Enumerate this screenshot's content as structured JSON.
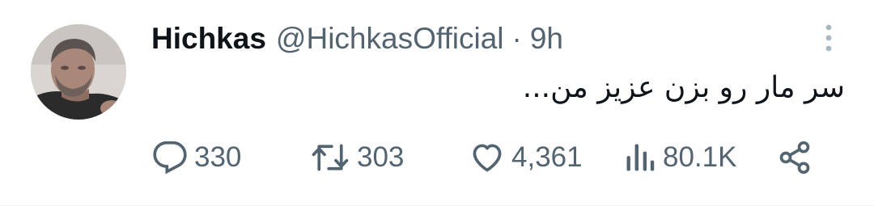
{
  "tweet": {
    "display_name": "Hichkas",
    "handle": "@HichkasOfficial",
    "separator": "·",
    "time": "9h",
    "text": "سر مار رو بزن عزیز من...",
    "avatar_icon": "user-avatar-photo",
    "more_icon": "vertical-ellipsis-icon"
  },
  "actions": {
    "reply": {
      "icon": "reply-icon",
      "count": "330"
    },
    "retweet": {
      "icon": "retweet-icon",
      "count": "303"
    },
    "like": {
      "icon": "heart-icon",
      "count": "4,361"
    },
    "views": {
      "icon": "views-chart-icon",
      "count": "80.1K"
    },
    "share": {
      "icon": "share-icon"
    }
  },
  "colors": {
    "text_primary": "#0f1419",
    "text_secondary": "#536471",
    "background": "#ffffff"
  }
}
